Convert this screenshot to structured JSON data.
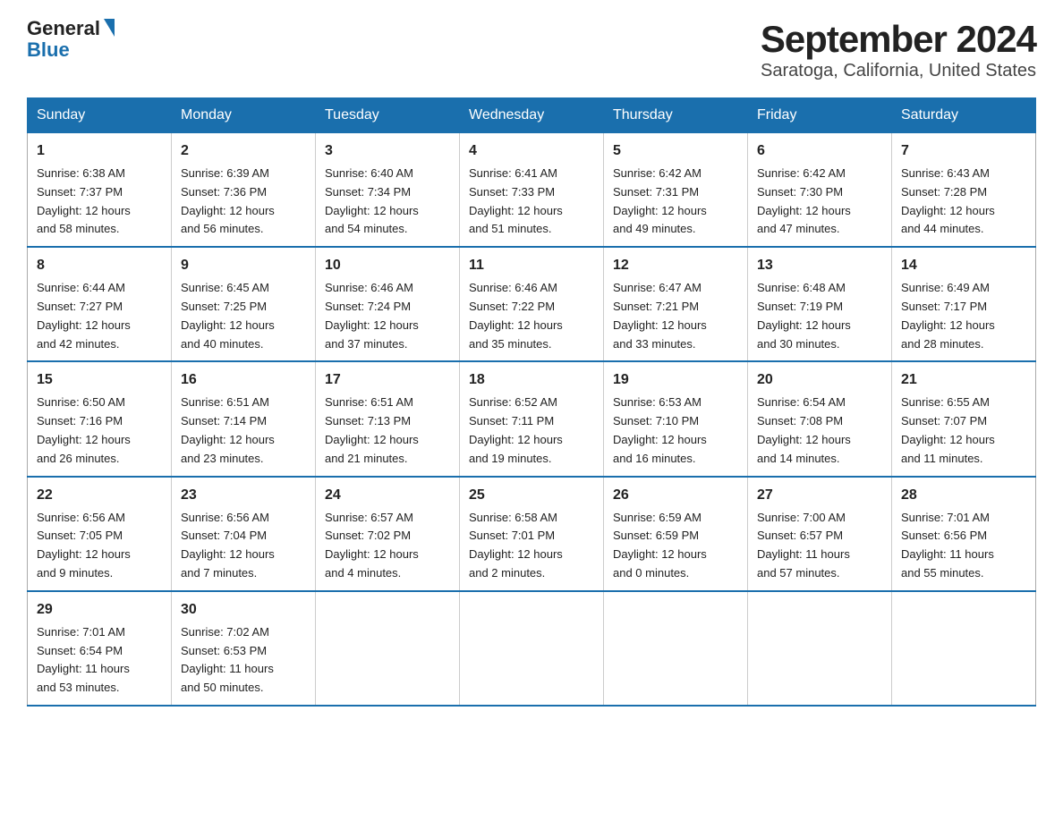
{
  "logo": {
    "general": "General",
    "blue": "Blue"
  },
  "title": "September 2024",
  "subtitle": "Saratoga, California, United States",
  "days_of_week": [
    "Sunday",
    "Monday",
    "Tuesday",
    "Wednesday",
    "Thursday",
    "Friday",
    "Saturday"
  ],
  "weeks": [
    [
      {
        "day": "1",
        "sunrise": "6:38 AM",
        "sunset": "7:37 PM",
        "daylight": "12 hours and 58 minutes."
      },
      {
        "day": "2",
        "sunrise": "6:39 AM",
        "sunset": "7:36 PM",
        "daylight": "12 hours and 56 minutes."
      },
      {
        "day": "3",
        "sunrise": "6:40 AM",
        "sunset": "7:34 PM",
        "daylight": "12 hours and 54 minutes."
      },
      {
        "day": "4",
        "sunrise": "6:41 AM",
        "sunset": "7:33 PM",
        "daylight": "12 hours and 51 minutes."
      },
      {
        "day": "5",
        "sunrise": "6:42 AM",
        "sunset": "7:31 PM",
        "daylight": "12 hours and 49 minutes."
      },
      {
        "day": "6",
        "sunrise": "6:42 AM",
        "sunset": "7:30 PM",
        "daylight": "12 hours and 47 minutes."
      },
      {
        "day": "7",
        "sunrise": "6:43 AM",
        "sunset": "7:28 PM",
        "daylight": "12 hours and 44 minutes."
      }
    ],
    [
      {
        "day": "8",
        "sunrise": "6:44 AM",
        "sunset": "7:27 PM",
        "daylight": "12 hours and 42 minutes."
      },
      {
        "day": "9",
        "sunrise": "6:45 AM",
        "sunset": "7:25 PM",
        "daylight": "12 hours and 40 minutes."
      },
      {
        "day": "10",
        "sunrise": "6:46 AM",
        "sunset": "7:24 PM",
        "daylight": "12 hours and 37 minutes."
      },
      {
        "day": "11",
        "sunrise": "6:46 AM",
        "sunset": "7:22 PM",
        "daylight": "12 hours and 35 minutes."
      },
      {
        "day": "12",
        "sunrise": "6:47 AM",
        "sunset": "7:21 PM",
        "daylight": "12 hours and 33 minutes."
      },
      {
        "day": "13",
        "sunrise": "6:48 AM",
        "sunset": "7:19 PM",
        "daylight": "12 hours and 30 minutes."
      },
      {
        "day": "14",
        "sunrise": "6:49 AM",
        "sunset": "7:17 PM",
        "daylight": "12 hours and 28 minutes."
      }
    ],
    [
      {
        "day": "15",
        "sunrise": "6:50 AM",
        "sunset": "7:16 PM",
        "daylight": "12 hours and 26 minutes."
      },
      {
        "day": "16",
        "sunrise": "6:51 AM",
        "sunset": "7:14 PM",
        "daylight": "12 hours and 23 minutes."
      },
      {
        "day": "17",
        "sunrise": "6:51 AM",
        "sunset": "7:13 PM",
        "daylight": "12 hours and 21 minutes."
      },
      {
        "day": "18",
        "sunrise": "6:52 AM",
        "sunset": "7:11 PM",
        "daylight": "12 hours and 19 minutes."
      },
      {
        "day": "19",
        "sunrise": "6:53 AM",
        "sunset": "7:10 PM",
        "daylight": "12 hours and 16 minutes."
      },
      {
        "day": "20",
        "sunrise": "6:54 AM",
        "sunset": "7:08 PM",
        "daylight": "12 hours and 14 minutes."
      },
      {
        "day": "21",
        "sunrise": "6:55 AM",
        "sunset": "7:07 PM",
        "daylight": "12 hours and 11 minutes."
      }
    ],
    [
      {
        "day": "22",
        "sunrise": "6:56 AM",
        "sunset": "7:05 PM",
        "daylight": "12 hours and 9 minutes."
      },
      {
        "day": "23",
        "sunrise": "6:56 AM",
        "sunset": "7:04 PM",
        "daylight": "12 hours and 7 minutes."
      },
      {
        "day": "24",
        "sunrise": "6:57 AM",
        "sunset": "7:02 PM",
        "daylight": "12 hours and 4 minutes."
      },
      {
        "day": "25",
        "sunrise": "6:58 AM",
        "sunset": "7:01 PM",
        "daylight": "12 hours and 2 minutes."
      },
      {
        "day": "26",
        "sunrise": "6:59 AM",
        "sunset": "6:59 PM",
        "daylight": "12 hours and 0 minutes."
      },
      {
        "day": "27",
        "sunrise": "7:00 AM",
        "sunset": "6:57 PM",
        "daylight": "11 hours and 57 minutes."
      },
      {
        "day": "28",
        "sunrise": "7:01 AM",
        "sunset": "6:56 PM",
        "daylight": "11 hours and 55 minutes."
      }
    ],
    [
      {
        "day": "29",
        "sunrise": "7:01 AM",
        "sunset": "6:54 PM",
        "daylight": "11 hours and 53 minutes."
      },
      {
        "day": "30",
        "sunrise": "7:02 AM",
        "sunset": "6:53 PM",
        "daylight": "11 hours and 50 minutes."
      },
      null,
      null,
      null,
      null,
      null
    ]
  ],
  "labels": {
    "sunrise": "Sunrise:",
    "sunset": "Sunset:",
    "daylight": "Daylight:"
  }
}
